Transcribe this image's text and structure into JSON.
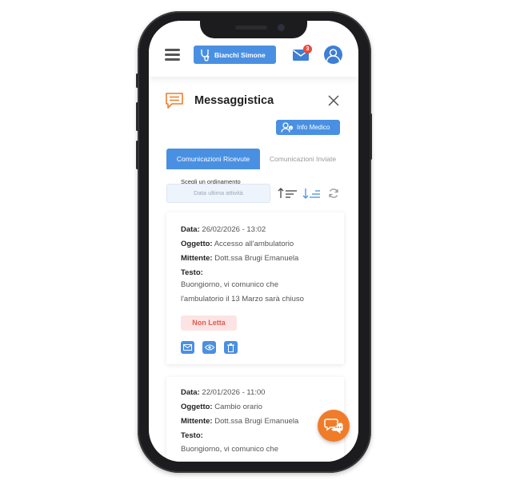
{
  "header": {
    "doctor_label": "Bianchi Simone",
    "mail_badge": "3"
  },
  "page": {
    "title": "Messaggistica",
    "info_button": "Info Medico"
  },
  "tabs": [
    {
      "label": "Comunicazioni Ricevute",
      "active": true
    },
    {
      "label": "Comunicazioni Inviate",
      "active": false
    }
  ],
  "sort": {
    "label": "Scegli un ordinamento",
    "placeholder": "Data ultima attività"
  },
  "labels": {
    "data": "Data:",
    "oggetto": "Oggetto:",
    "mittente": "Mittente:",
    "testo": "Testo:"
  },
  "messages": [
    {
      "data": "26/02/2026 - 13:02",
      "oggetto": "Accesso all'ambulatorio",
      "mittente": "Dott.ssa Brugi Emanuela",
      "testo_line1": "Buongiorno, vi comunico che",
      "testo_line2": "l'ambulatorio il 13 Marzo sarà chiuso",
      "status": "Non Letta"
    },
    {
      "data": "22/01/2026 - 11:00",
      "oggetto": "Cambio orario",
      "mittente": "Dott.ssa Brugi Emanuela",
      "testo_line1": "Buongiorno, vi comunico che"
    }
  ],
  "colors": {
    "primary": "#4a90e2",
    "accent": "#f07c2a",
    "unread_bg": "#fde4e4",
    "unread_text": "#e05a4f"
  }
}
